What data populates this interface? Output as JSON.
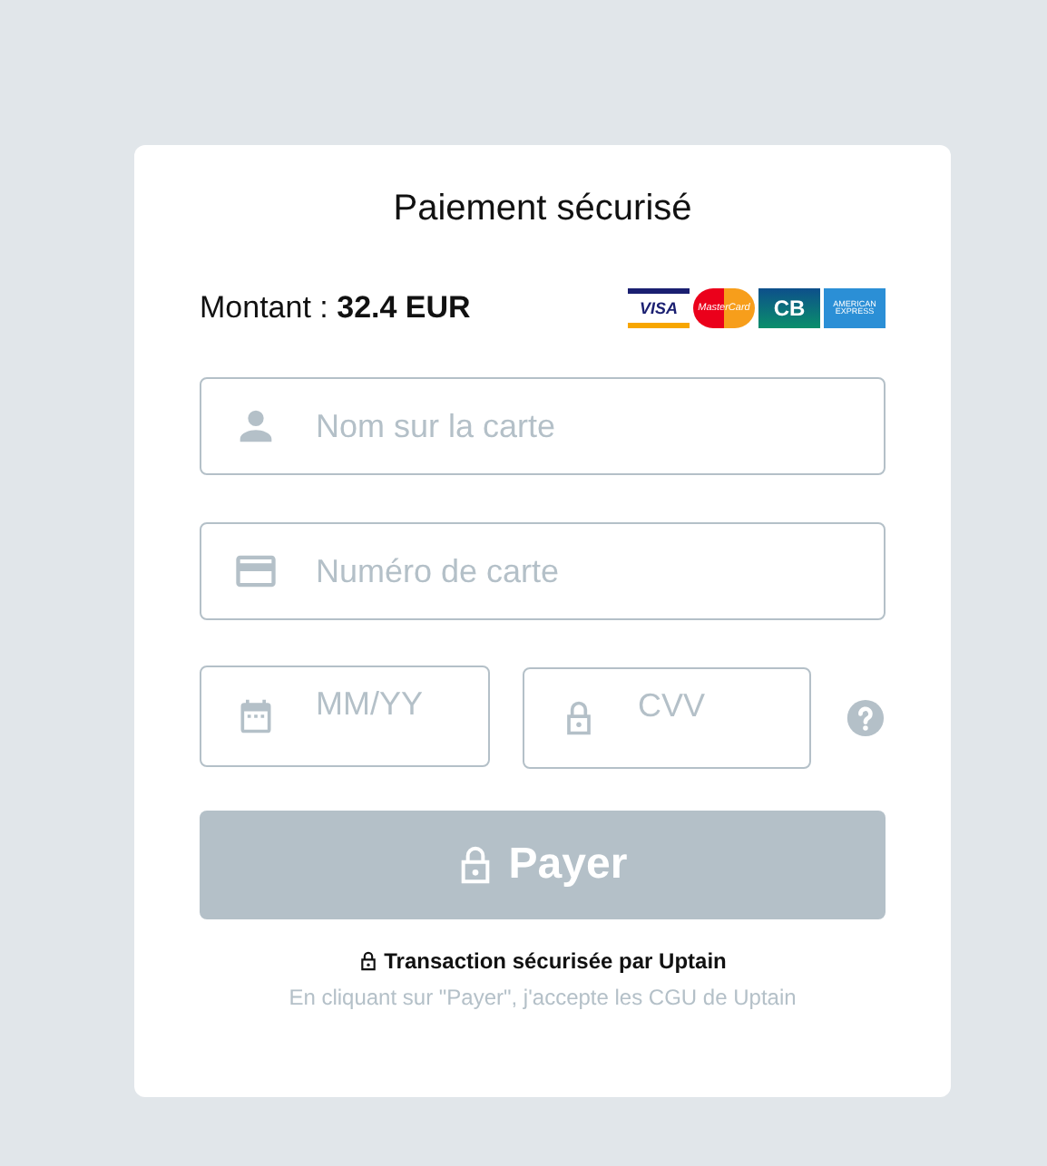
{
  "title": "Paiement sécurisé",
  "amount": {
    "label": "Montant : ",
    "value": "32.4 EUR"
  },
  "card_brands": [
    {
      "kind": "visa",
      "label": "VISA"
    },
    {
      "kind": "mastercard",
      "label": "MasterCard"
    },
    {
      "kind": "cb",
      "label": "CB"
    },
    {
      "kind": "amex",
      "label": "AMERICAN EXPRESS"
    }
  ],
  "fields": [
    {
      "kind": "name",
      "placeholder": "Nom sur la carte"
    },
    {
      "kind": "card",
      "placeholder": "Numéro de carte"
    }
  ],
  "small_fields": [
    {
      "kind": "date",
      "placeholder": "MM/YY"
    },
    {
      "kind": "cvv",
      "placeholder": "CVV"
    }
  ],
  "pay_button": {
    "label": "Payer",
    "disabled": true
  },
  "secure_note": "Transaction sécurisée par Uptain",
  "terms": "En cliquant sur \"Payer\", j'accepte les CGU de Uptain"
}
